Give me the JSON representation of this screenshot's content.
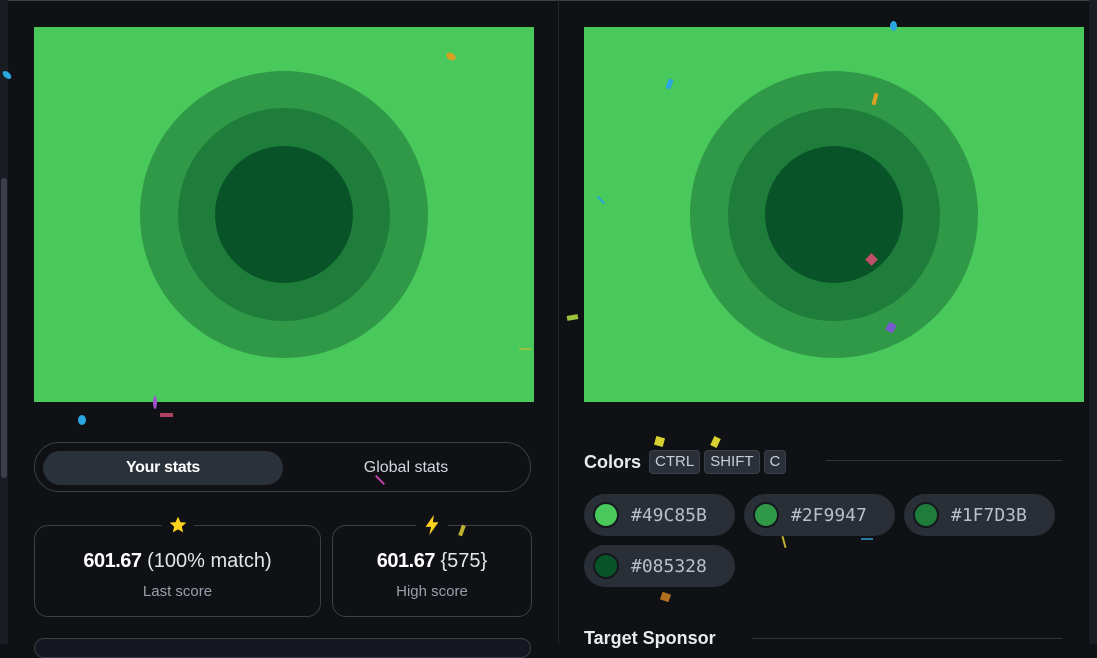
{
  "target_image": {
    "background": "#49C85B",
    "rings": [
      "#2F9947",
      "#1F7D3B",
      "#085328"
    ]
  },
  "your_image": {
    "background": "#49C85B",
    "rings": [
      "#2F9947",
      "#1F7D3B",
      "#085328"
    ]
  },
  "stats_tabs": {
    "your_stats": "Your stats",
    "global_stats": "Global stats"
  },
  "last_score": {
    "icon": "star-icon",
    "value": "601.67",
    "detail": "(100% match)",
    "label": "Last score"
  },
  "high_score": {
    "icon": "lightning-icon",
    "value": "601.67",
    "detail": "{575}",
    "label": "High score"
  },
  "colors": {
    "title": "Colors",
    "shortcut": [
      "CTRL",
      "SHIFT",
      "C"
    ],
    "items": [
      {
        "hex": "#49C85B",
        "swatch": "#49C85B"
      },
      {
        "hex": "#2F9947",
        "swatch": "#2F9947"
      },
      {
        "hex": "#1F7D3B",
        "swatch": "#1F7D3B"
      },
      {
        "hex": "#085328",
        "swatch": "#085328"
      }
    ]
  },
  "sponsor": {
    "title": "Target Sponsor"
  }
}
